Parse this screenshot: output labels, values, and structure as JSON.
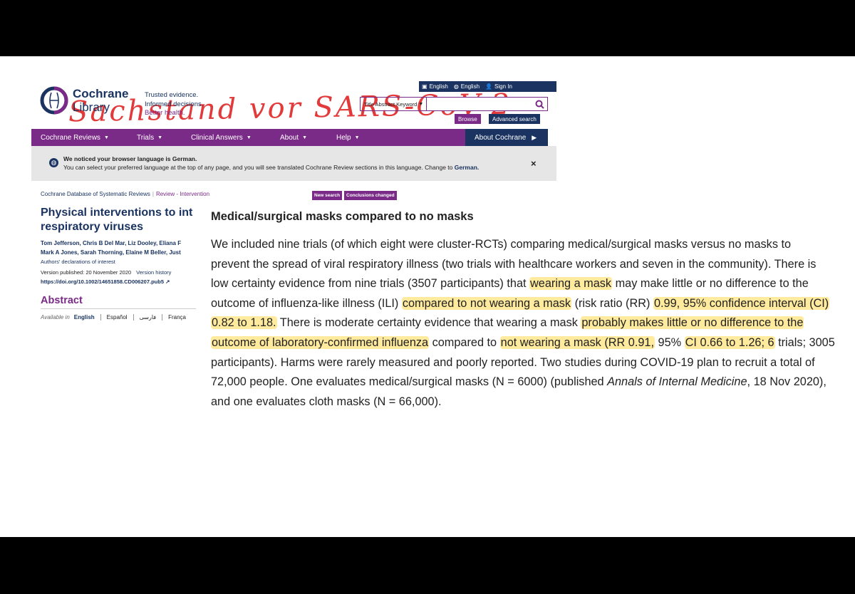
{
  "handwriting": "Sachstand vor SARS-CoV-2",
  "util_bar": [
    {
      "icon": "document-icon",
      "label": "English"
    },
    {
      "icon": "globe-icon",
      "label": "English"
    },
    {
      "icon": "user-icon",
      "label": "Sign In"
    }
  ],
  "logo": {
    "line1": "Cochrane",
    "line2": "Library"
  },
  "tagline": [
    "Trusted evidence.",
    "Informed decisions.",
    "Better health."
  ],
  "search": {
    "scope": "Title Abstract Keyword",
    "value": "",
    "browse_label": "Browse",
    "advanced_label": "Advanced search"
  },
  "nav": [
    {
      "label": "Cochrane Reviews"
    },
    {
      "label": "Trials"
    },
    {
      "label": "Clinical Answers"
    },
    {
      "label": "About"
    },
    {
      "label": "Help"
    }
  ],
  "about_cochrane": "About Cochrane",
  "notice": {
    "title": "We noticed your browser language is German.",
    "body": "You can select your preferred language at the top of any page, and you will see translated Cochrane Review sections in this language. Change to",
    "link": "German.",
    "close": "×"
  },
  "breadcrumb": {
    "db": "Cochrane Database of Systematic Reviews",
    "sep": "|",
    "type": "Review - Intervention"
  },
  "badges": {
    "new_search": "New search",
    "conclusions_changed": "Conclusions changed"
  },
  "article": {
    "title_line1": "Physical interventions to int",
    "title_line2": "respiratory viruses",
    "authors_line1": "Tom Jefferson, Chris B Del Mar, Liz Dooley, Eliana F",
    "authors_line2": "Mark A Jones, Sarah Thorning, Elaine M Beller, Just",
    "declarations": "Authors' declarations of interest",
    "version": "Version published: 20 November 2020",
    "version_history": "Version history",
    "doi": "https://doi.org/10.1002/14651858.CD006207.pub5"
  },
  "abstract": {
    "heading": "Abstract",
    "available_in": "Available in",
    "languages": [
      "English",
      "Español",
      "فارسی",
      "França"
    ]
  },
  "main": {
    "heading": "Medical/surgical masks compared to no masks",
    "l1": "We included nine trials (of which eight were cluster-RCTs) comparing medical/surgical masks versus no masks to",
    "l2": "prevent the spread of viral respiratory illness (two trials with healthcare workers and seven in the community). There is",
    "l3a": "low certainty evidence from nine trials (3507 participants) that ",
    "l3b": "wearing a mask",
    "l3c": " may make little or no difference to the",
    "l4a": "outcome of influenza-like illness (ILI) ",
    "l4b": "compared to not wearing a mask",
    "l4c": " (risk ratio (RR) ",
    "l4d": "0.99, 95% confidence interval (CI)",
    "l5a": "0.82 to 1.18.",
    "l5b": " There is moderate certainty evidence that wearing a mask ",
    "l5c": "probably makes little or no difference to the",
    "l6a": "outcome of laboratory-confirmed influenza",
    "l6b": " compared to ",
    "l6c": "not wearing a mask (RR 0.91,",
    "l6d": " 95% ",
    "l6e": "CI 0.66 to 1.26; 6",
    "l6f": " trials; 3005",
    "l7": "participants). Harms were rarely measured and poorly reported. Two studies during COVID-19 plan to recruit a total of",
    "l8a": "72,000 people. One evaluates medical/surgical masks (N = 6000) (published ",
    "l8b": "Annals of Internal Medicine",
    "l8c": ", 18 Nov 2020),",
    "l9": "and one evaluates cloth masks (N = 66,000)."
  },
  "colors": {
    "purple": "#7a2a87",
    "navy": "#1a3360",
    "highlight": "#ffe278",
    "handwriting": "#e23a3a"
  }
}
